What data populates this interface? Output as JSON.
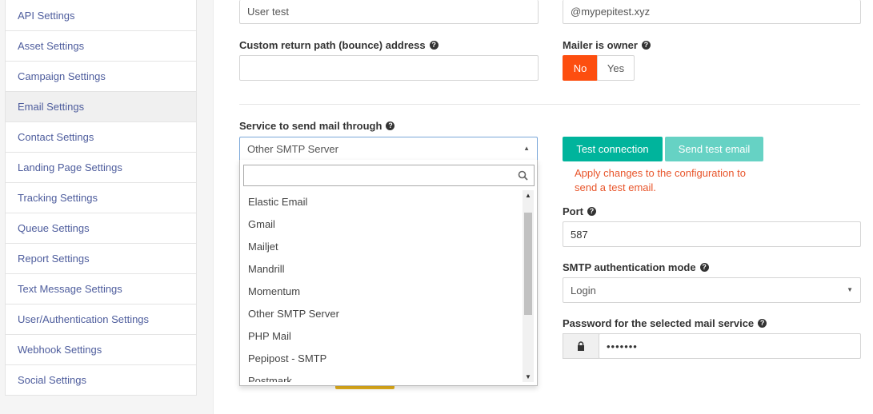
{
  "sidebar": {
    "items": [
      {
        "label": "API Settings"
      },
      {
        "label": "Asset Settings"
      },
      {
        "label": "Campaign Settings"
      },
      {
        "label": "Email Settings"
      },
      {
        "label": "Contact Settings"
      },
      {
        "label": "Landing Page Settings"
      },
      {
        "label": "Tracking Settings"
      },
      {
        "label": "Queue Settings"
      },
      {
        "label": "Report Settings"
      },
      {
        "label": "Text Message Settings"
      },
      {
        "label": "User/Authentication Settings"
      },
      {
        "label": "Webhook Settings"
      },
      {
        "label": "Social Settings"
      }
    ]
  },
  "form": {
    "from_name_value": "User test",
    "from_email_value": "@mypepitest.xyz",
    "return_path_label": "Custom return path (bounce) address",
    "return_path_value": "",
    "mailer_owner_label": "Mailer is owner",
    "mailer_owner_no": "No",
    "mailer_owner_yes": "Yes",
    "service_label": "Service to send mail through",
    "service_value": "Other SMTP Server",
    "test_connection": "Test connection",
    "send_test_email": "Send test email",
    "apply_notice": "Apply changes to the configuration to send a test email.",
    "port_label": "Port",
    "port_value": "587",
    "auth_mode_label": "SMTP authentication mode",
    "auth_mode_value": "Login",
    "password_label": "Password for the selected mail service",
    "password_value": "•••••••"
  },
  "dropdown": {
    "search_value": "",
    "options": [
      "Elastic Email",
      "Gmail",
      "Mailjet",
      "Mandrill",
      "Momentum",
      "Other SMTP Server",
      "PHP Mail",
      "Pepipost - SMTP",
      "Postmark"
    ]
  },
  "colors": {
    "accent_danger": "#fd4e0f",
    "accent_success": "#00b49c",
    "accent_success_light": "#66d2c4",
    "notice": "#e8552b",
    "link": "#4e5d9d"
  },
  "icons": {
    "help": "question-circle-icon",
    "search": "search-icon",
    "lock": "lock-icon",
    "caret": "caret-icon"
  }
}
